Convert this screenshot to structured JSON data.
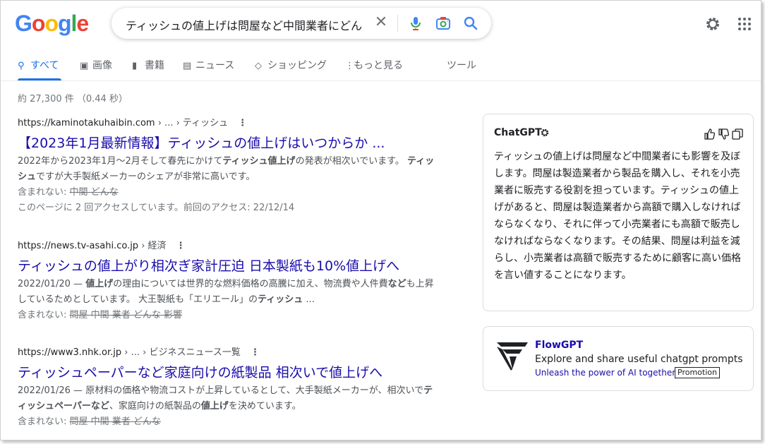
{
  "logo": {
    "text": "Google"
  },
  "search": {
    "query": "ティッシュの値上げは問屋など中間業者にどん"
  },
  "tabs": [
    {
      "icon": "search-icon",
      "label": "すべて"
    },
    {
      "icon": "image-icon",
      "label": "画像"
    },
    {
      "icon": "book-icon",
      "label": "書籍"
    },
    {
      "icon": "news-icon",
      "label": "ニュース"
    },
    {
      "icon": "tag-icon",
      "label": "ショッピング"
    },
    {
      "icon": "more-vert-icon",
      "label": "もっと見る"
    },
    {
      "icon": "",
      "label": "ツール"
    }
  ],
  "stats": "約 27,300 件 （0.44 秒）",
  "results": [
    {
      "url": "https://kaminotakuhaibin.com",
      "crumb": " › ... › ティッシュ",
      "title": "【2023年1月最新情報】ティッシュの値上げはいつからか ...",
      "snippet_1": "2022年から2023年1月〜2月そして春先にかけて",
      "snippet_bold_1": "ティッシュ値上げ",
      "snippet_2": "の発表が相次いでいます。",
      "snippet_bold_2": "ティッシュ",
      "snippet_3": "ですが大手製紙メーカーのシェアが非常に高いです。",
      "missing_label": "含まれない: ",
      "missing_terms": "中間 どんな",
      "visited": "このページに 2 回アクセスしています。前回のアクセス: 22/12/14"
    },
    {
      "url": "https://news.tv-asahi.co.jp",
      "crumb": " › 経済",
      "title": "ティッシュの値上がり相次ぎ家計圧迫 日本製紙も10%値上げへ",
      "snippet_date": "2022/01/20 — ",
      "snippet_bold_1": "値上げ",
      "snippet_2": "の理由については世界的な燃料価格の高騰に加え、物流費や人件費",
      "snippet_bold_2": "など",
      "snippet_3": "も上昇しているためとしています。 大王製紙も「エリエール」の",
      "snippet_bold_3": "ティッシュ",
      "snippet_4": " ...",
      "missing_label": "含まれない: ",
      "missing_terms": "問屋 中間 業者 どんな 影響"
    },
    {
      "url": "https://www3.nhk.or.jp",
      "crumb": " › ... › ビジネスニュース一覧",
      "title": "ティッシュペーパーなど家庭向けの紙製品 相次いで値上げへ",
      "snippet_date": "2022/01/26 — ",
      "snippet_1": "原材料の価格や物流コストが上昇しているとして、大手製紙メーカーが、相次いで",
      "snippet_bold_1": "ティッシュペーパーなど",
      "snippet_2": "、家庭向けの紙製品の",
      "snippet_bold_2": "値上げ",
      "snippet_3": "を決めています。",
      "missing_label": "含まれない: ",
      "missing_terms": "問屋 中間 業者 どんな"
    }
  ],
  "panel": {
    "title": "ChatGPT",
    "body": "ティッシュの値上げは問屋など中間業者にも影響を及ぼします。問屋は製造業者から製品を購入し、それを小売業者に販売する役割を担っています。ティッシュの値上げがあると、問屋は製造業者から高額で購入しなければならなくなり、それに伴って小売業者にも高額で販売しなければならなくなります。その結果、問屋は利益を減らし、小売業者は高額で販売するために顧客に高い価格を言い値することになります。"
  },
  "promo": {
    "title": "FlowGPT",
    "desc": "Explore and share useful chatgpt prompts",
    "sub": "Unleash the power of AI together",
    "badge": "Promotion"
  },
  "colors": {
    "link": "#1a0dab",
    "accent": "#1a73e8",
    "text": "#202124",
    "muted": "#70757a"
  }
}
